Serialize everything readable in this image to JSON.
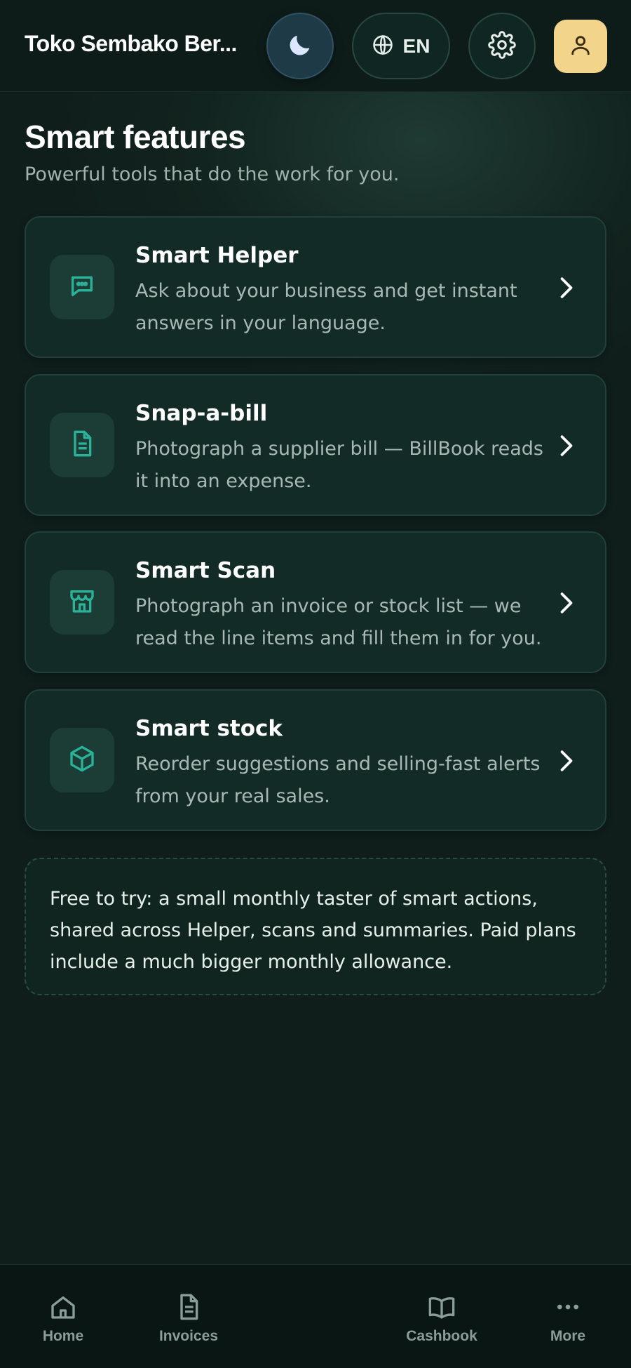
{
  "header": {
    "store_name": "Toko Sembako Ber...",
    "language_label": "EN",
    "icons": {
      "theme": "moon-icon",
      "language": "globe-icon",
      "settings": "gear-icon",
      "profile": "user-icon"
    }
  },
  "page": {
    "title": "Smart features",
    "subtitle": "Powerful tools that do the work for you."
  },
  "features": [
    {
      "title": "Smart Helper",
      "description": "Ask about your business and get instant answers in your language.",
      "icon": "chat-bubble-icon"
    },
    {
      "title": "Snap-a-bill",
      "description": "Photograph a supplier bill — BillBook reads it into an expense.",
      "icon": "document-icon"
    },
    {
      "title": "Smart Scan",
      "description": "Photograph an invoice or stock list — we read the line items and fill them in for you.",
      "icon": "store-icon"
    },
    {
      "title": "Smart stock",
      "description": "Reorder suggestions and selling-fast alerts from your real sales.",
      "icon": "box-icon"
    }
  ],
  "note": {
    "text": "Free to try: a small monthly taster of smart actions, shared across Helper, scans and summaries. Paid plans include a much bigger monthly allowance."
  },
  "bottom_nav": {
    "items": [
      {
        "label": "Home",
        "icon": "home-icon"
      },
      {
        "label": "Invoices",
        "icon": "document-icon"
      },
      {
        "label": "Cashbook",
        "icon": "book-icon"
      },
      {
        "label": "More",
        "icon": "more-dots-icon"
      }
    ]
  },
  "colors": {
    "background": "#0f1e1b",
    "card": "#132b26",
    "accent": "#2bb39a",
    "avatar": "#f2d48a"
  }
}
